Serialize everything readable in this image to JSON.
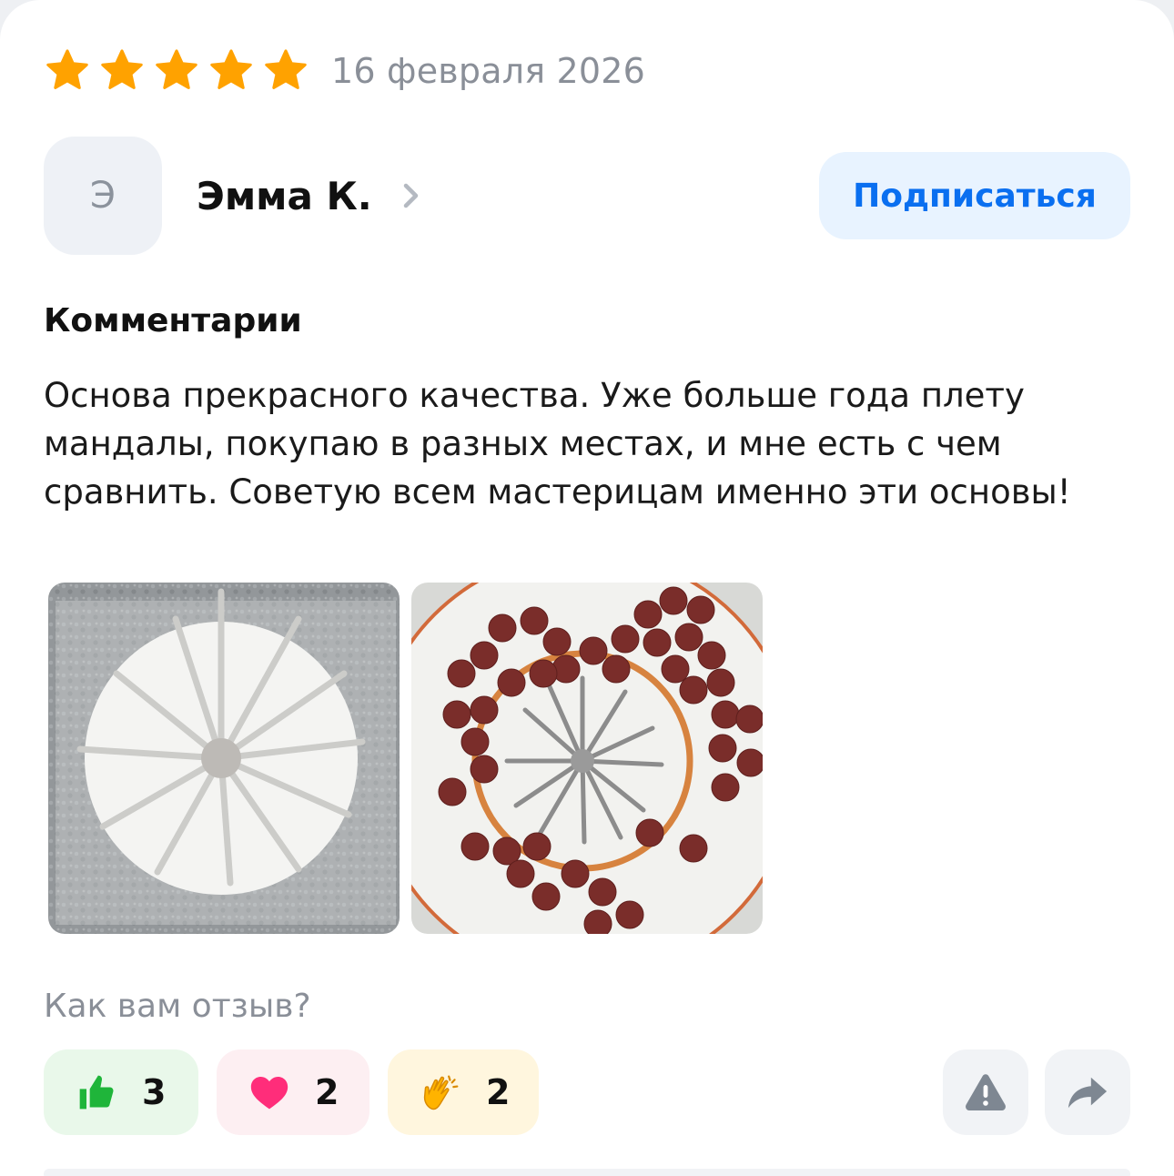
{
  "review": {
    "rating": 5,
    "max_rating": 5,
    "date": "16 февраля 2026",
    "star_color": "#ffa200"
  },
  "author": {
    "initial": "Э",
    "name": "Эмма К.",
    "subscribe_label": "Подписаться"
  },
  "comments": {
    "title": "Комментарии",
    "text": "Основа прекрасного качества. Уже больше года плету мандалы, покупаю в разных местах, и мне есть с чем сравнить. Советую всем мастерицам именно эти основы!"
  },
  "photos": [
    {
      "icon": "photo-mandala-base-in-bag"
    },
    {
      "icon": "photo-mandala-base-with-beads-on-plate"
    }
  ],
  "feedback": {
    "question": "Как вам отзыв?",
    "reactions": [
      {
        "icon": "thumbs-up-icon",
        "count": "3",
        "color": "#1fb53a"
      },
      {
        "icon": "heart-icon",
        "count": "2",
        "color": "#ff2d7a"
      },
      {
        "icon": "clap-icon",
        "count": "2",
        "color": "#ffb300"
      }
    ],
    "actions": [
      {
        "icon": "warning-icon"
      },
      {
        "icon": "share-icon"
      }
    ]
  },
  "colors": {
    "accent": "#0a6ff0",
    "muted_text": "#8a8f98"
  }
}
